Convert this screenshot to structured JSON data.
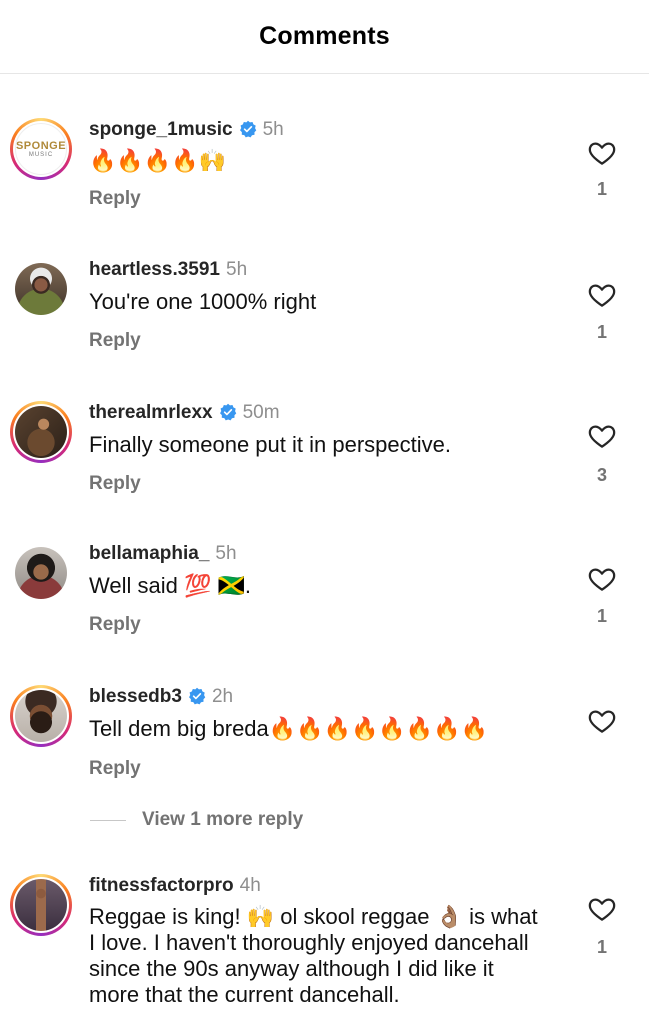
{
  "header": {
    "title": "Comments"
  },
  "comments": [
    {
      "username": "sponge_1music",
      "verified": true,
      "time": "5h",
      "text": "🔥🔥🔥🔥🙌",
      "reply": "Reply",
      "likes": "1",
      "avatar_label": "SPONGE",
      "avatar_sub": "MUSIC"
    },
    {
      "username": "heartless.3591",
      "verified": false,
      "time": "5h",
      "text": "You're one  1000% right",
      "reply": "Reply",
      "likes": "1"
    },
    {
      "username": "therealmrlexx",
      "verified": true,
      "time": "50m",
      "text": "Finally someone put it in perspective.",
      "reply": "Reply",
      "likes": "3"
    },
    {
      "username": "bellamaphia_",
      "verified": false,
      "time": "5h",
      "text": "Well said 💯 🇯🇲.",
      "reply": "Reply",
      "likes": "1"
    },
    {
      "username": "blessedb3",
      "verified": true,
      "time": "2h",
      "text": "Tell dem big breda🔥🔥🔥🔥🔥🔥🔥🔥",
      "reply": "Reply",
      "likes": ""
    },
    {
      "username": "fitnessfactorpro",
      "verified": false,
      "time": "4h",
      "text": "Reggae is king! 🙌 ol skool reggae 👌🏽 is what I love. I haven't thoroughly enjoyed dancehall since the 90s anyway although I did like it more that the current dancehall.",
      "reply": "",
      "likes": "1"
    }
  ],
  "view_more": "View 1 more reply",
  "colors": {
    "ring_start": "#feda75",
    "ring_end": "#962fbf",
    "verified": "#3897f0",
    "muted": "#737373"
  },
  "icons": {
    "like": "heart-outline-icon",
    "verified": "verified-badge-icon"
  }
}
